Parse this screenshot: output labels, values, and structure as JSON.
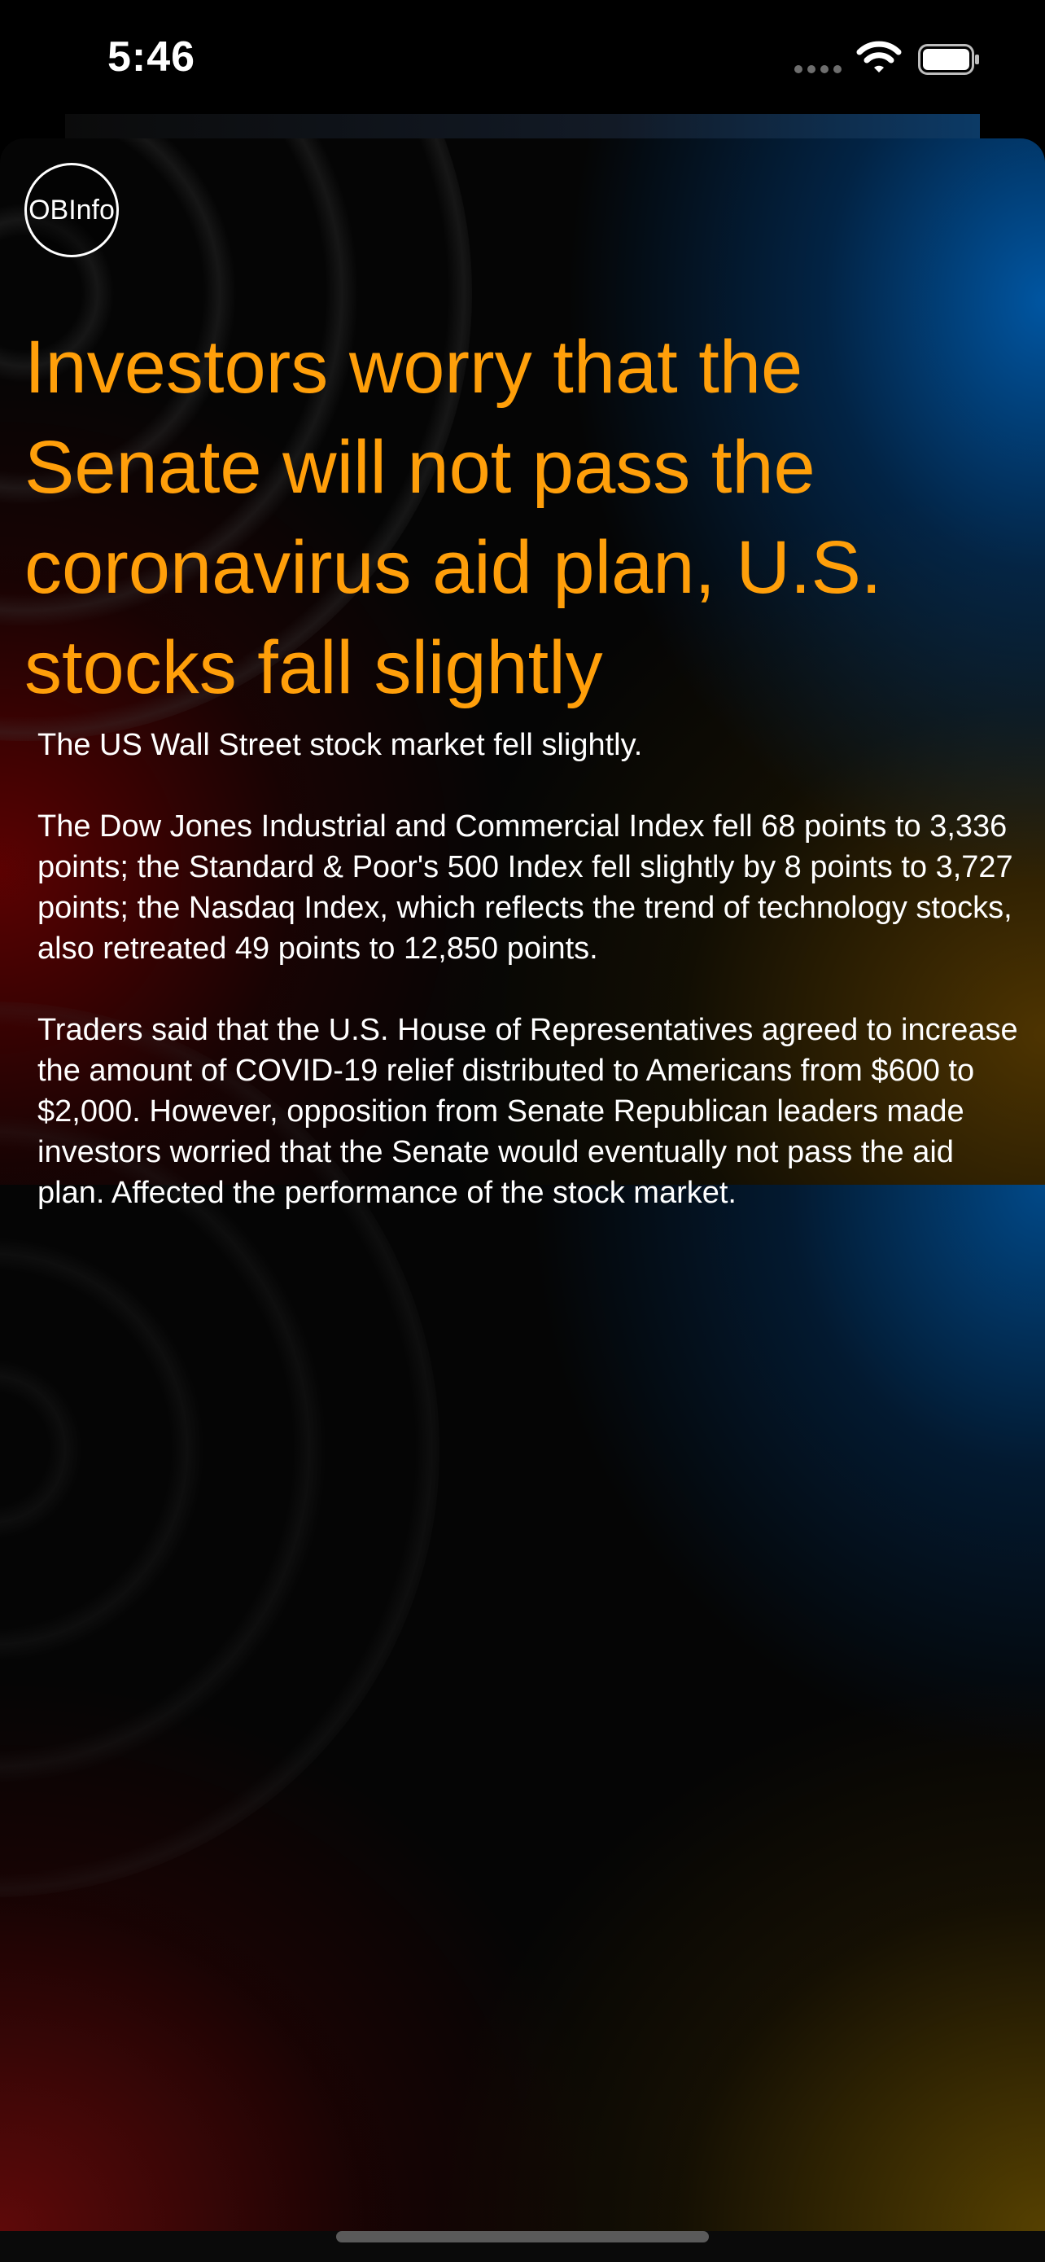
{
  "status_bar": {
    "time": "5:46",
    "icons": [
      "cellular-signal-icon",
      "wifi-icon",
      "battery-icon"
    ]
  },
  "colors": {
    "headline": "#ff9f0a",
    "body_text": "#ffffff",
    "background": "#000000"
  },
  "article": {
    "source_badge": "OBInfo",
    "headline": "Investors worry that the Senate will not pass the coronavirus aid plan, U.S. stocks fall slightly",
    "paragraphs": [
      "The US Wall Street stock market fell slightly.",
      "The Dow Jones Industrial and Commercial Index fell 68 points to 3,336 points; the Standard & Poor's 500 Index fell slightly by 8 points to 3,727 points; the Nasdaq Index, which reflects the trend of technology stocks, also retreated 49 points to 12,850 points.",
      "Traders said that the U.S. House of Representatives agreed to increase the amount of COVID-19 relief distributed to Americans from $600 to $2,000. However, opposition from Senate Republican leaders made investors worried that the Senate would eventually not pass the aid plan. Affected the performance of the stock market."
    ]
  }
}
